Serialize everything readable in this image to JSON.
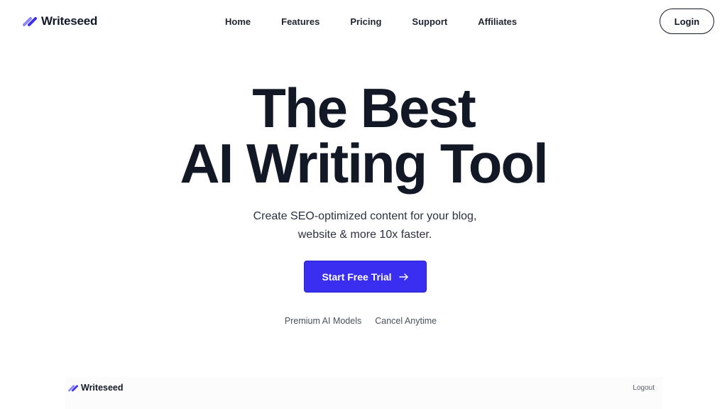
{
  "header": {
    "brand": "Writeseed",
    "nav": [
      {
        "label": "Home"
      },
      {
        "label": "Features"
      },
      {
        "label": "Pricing"
      },
      {
        "label": "Support"
      },
      {
        "label": "Affiliates"
      }
    ],
    "login_label": "Login"
  },
  "hero": {
    "title_line1": "The Best",
    "title_line2": "AI Writing Tool",
    "subtitle_line1": "Create SEO-optimized content for your blog,",
    "subtitle_line2": "website & more 10x faster.",
    "cta_label": "Start Free Trial",
    "features": [
      "Premium AI Models",
      "Cancel Anytime"
    ]
  },
  "preview": {
    "brand": "Writeseed",
    "logout_label": "Logout"
  },
  "colors": {
    "brand_primary": "#3a2ef0",
    "brand_secondary": "#8b86f7",
    "text_dark": "#121826"
  },
  "icons": {
    "logo": "writeseed-slash-logo-icon",
    "cta_arrow": "arrow-right-icon"
  }
}
